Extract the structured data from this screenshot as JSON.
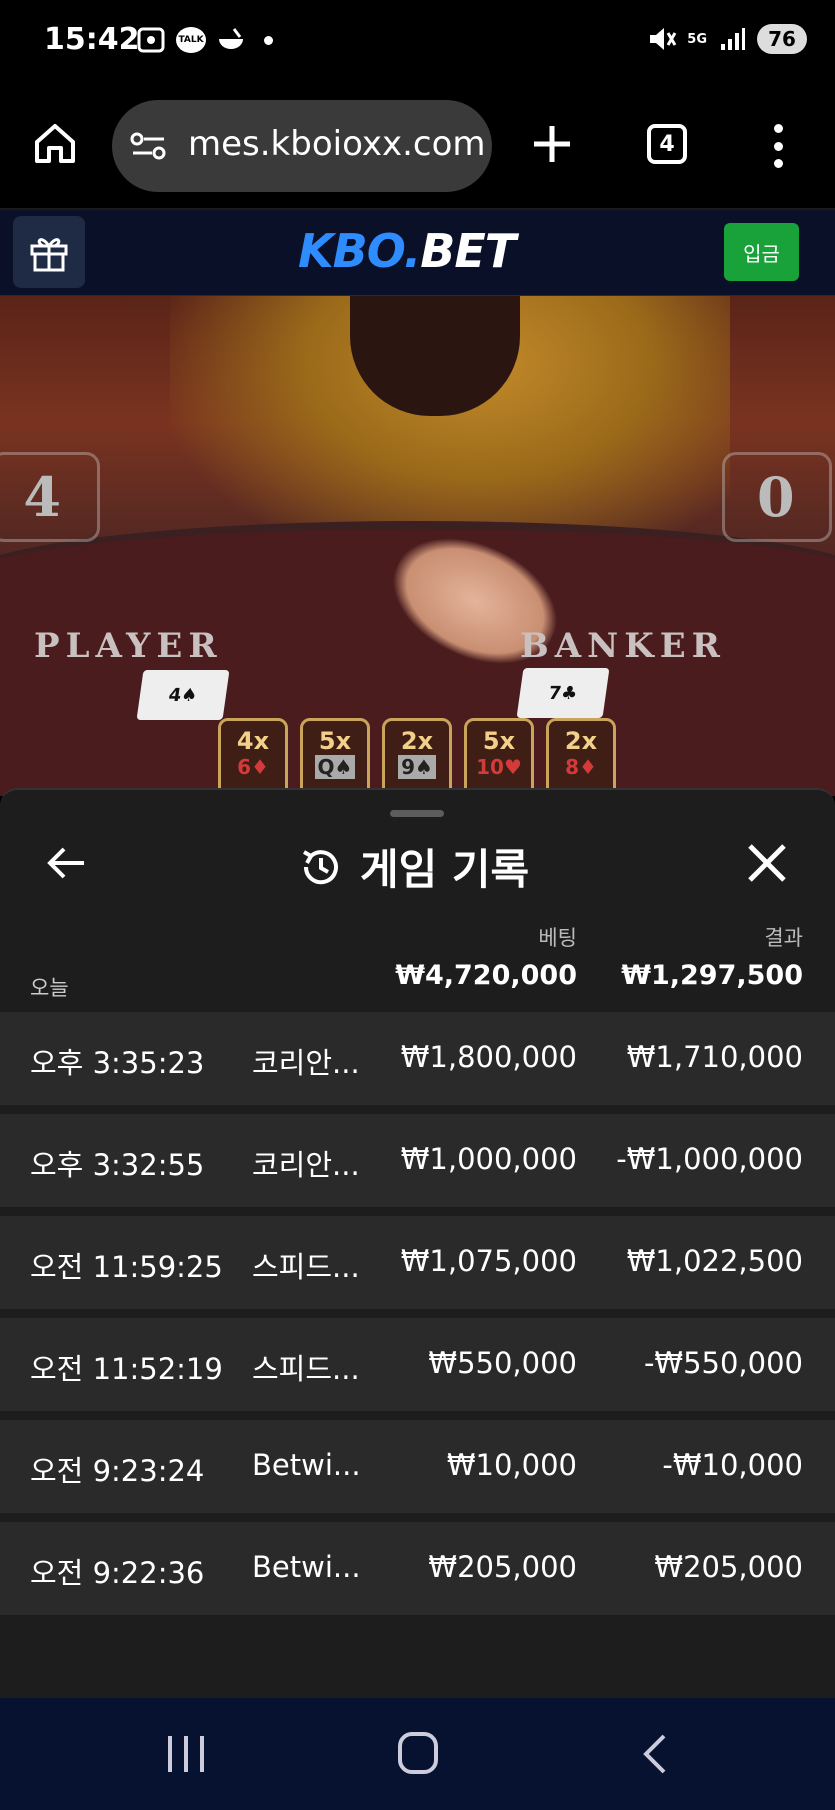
{
  "status_bar": {
    "time": "15:42",
    "talk_label": "TALK",
    "network": "5G",
    "battery": "76"
  },
  "browser": {
    "url": "mes.kboioxx.com",
    "tab_count": "4"
  },
  "site": {
    "logo_kbo": "KBO.",
    "logo_bet": "BET",
    "deposit_label": "입금"
  },
  "game_view": {
    "player_score": "4",
    "banker_score": "0",
    "player_label": "PLAYER",
    "banker_label": "BANKER",
    "player_card": "4♠",
    "banker_card": "7♣",
    "multipliers": [
      {
        "mult": "4x",
        "card": "6♦",
        "color": "red"
      },
      {
        "mult": "5x",
        "card": "Q♠",
        "color": "black"
      },
      {
        "mult": "2x",
        "card": "9♠",
        "color": "black"
      },
      {
        "mult": "5x",
        "card": "10♥",
        "color": "red"
      },
      {
        "mult": "2x",
        "card": "8♦",
        "color": "red"
      }
    ]
  },
  "history_panel": {
    "title": "게임 기록",
    "col_bet": "베팅",
    "col_result": "결과",
    "today_label": "오늘",
    "today_bet": "₩4,720,000",
    "today_result": "₩1,297,500",
    "rows": [
      {
        "time": "오후 3:35:23",
        "game": "코리안...",
        "bet": "₩1,800,000",
        "result": "₩1,710,000"
      },
      {
        "time": "오후 3:32:55",
        "game": "코리안...",
        "bet": "₩1,000,000",
        "result": "-₩1,000,000"
      },
      {
        "time": "오전 11:59:25",
        "game": "스피드...",
        "bet": "₩1,075,000",
        "result": "₩1,022,500"
      },
      {
        "time": "오전 11:52:19",
        "game": "스피드...",
        "bet": "₩550,000",
        "result": "-₩550,000"
      },
      {
        "time": "오전 9:23:24",
        "game": "Betwi...",
        "bet": "₩10,000",
        "result": "-₩10,000"
      },
      {
        "time": "오전 9:22:36",
        "game": "Betwi...",
        "bet": "₩205,000",
        "result": "₩205,000"
      }
    ]
  },
  "colors": {
    "brand_blue": "#2f8cff",
    "deposit_green": "#1aa23a",
    "panel_bg": "#1d1d1d",
    "row_bg": "#2a2a2a"
  }
}
